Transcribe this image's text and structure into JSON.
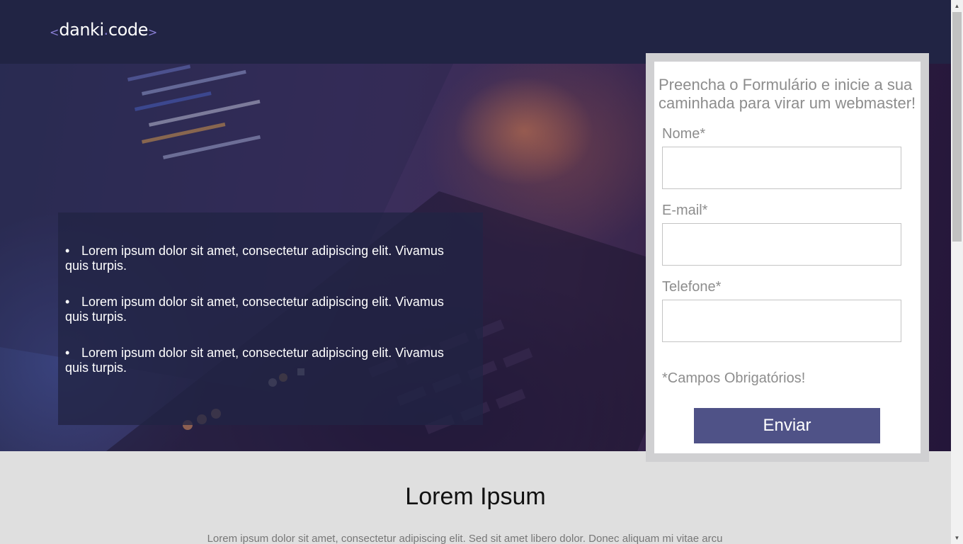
{
  "header": {
    "logo": {
      "left": "<",
      "word1": "danki",
      "dot": ".",
      "word2": "code",
      "right": ">"
    }
  },
  "hero": {
    "features": [
      "Lorem ipsum dolor sit amet, consectetur adipiscing elit. Vivamus quis turpis.",
      "Lorem ipsum dolor sit amet, consectetur adipiscing elit. Vivamus quis turpis.",
      "Lorem ipsum dolor sit amet, consectetur adipiscing elit. Vivamus quis turpis."
    ],
    "bullet": "•"
  },
  "form": {
    "title": "Preencha o Formulário e inicie a sua caminhada para virar um webmaster!",
    "fields": [
      {
        "label": "Nome*",
        "value": ""
      },
      {
        "label": "E-mail*",
        "value": ""
      },
      {
        "label": "Telefone*",
        "value": ""
      }
    ],
    "required_note": "*Campos Obrigatórios!",
    "submit_label": "Enviar"
  },
  "section": {
    "title": "Lorem Ipsum",
    "text": "Lorem ipsum dolor sit amet, consectetur adipiscing elit. Sed sit amet libero dolor. Donec aliquam mi vitae arcu"
  },
  "scrollbar": {
    "up_icon": "▲",
    "down_icon": "▼"
  },
  "colors": {
    "header_bg": "#212444",
    "feature_box_bg": "#212444",
    "submit_bg": "#4f5287",
    "page_bg": "#dfdfdf",
    "logo_accent": "#8a7fd6"
  }
}
